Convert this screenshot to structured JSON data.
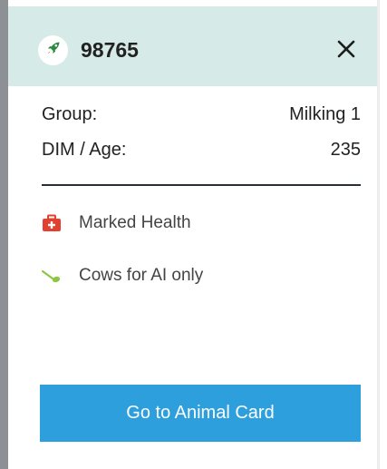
{
  "header": {
    "animal_id": "98765",
    "badge_icon": "rocket-icon",
    "close_icon": "close-icon"
  },
  "details": {
    "group_label": "Group:",
    "group_value": "Milking 1",
    "dim_label": "DIM / Age:",
    "dim_value": "235"
  },
  "tags": [
    {
      "icon": "medical-kit-icon",
      "label": "Marked Health",
      "color": "#e2412f"
    },
    {
      "icon": "insemination-icon",
      "label": "Cows for AI only",
      "color": "#8cc63f"
    }
  ],
  "actions": {
    "primary_label": "Go to Animal Card"
  },
  "colors": {
    "header_bg": "#d6ebe8",
    "primary": "#2d9fdc",
    "text": "#222222"
  }
}
